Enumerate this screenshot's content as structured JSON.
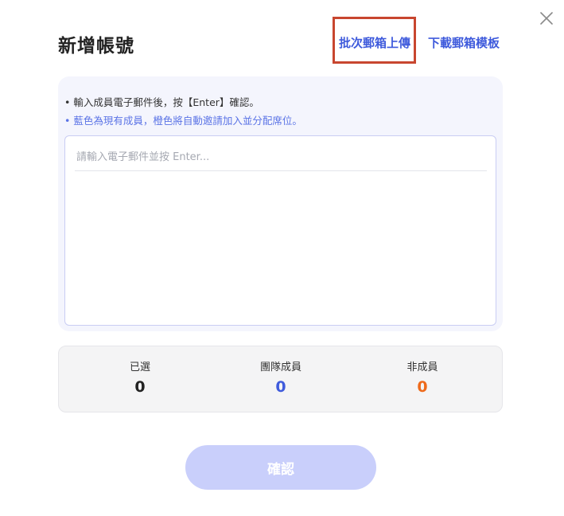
{
  "dialog": {
    "title": "新增帳號",
    "links": {
      "batch_upload": "批次郵箱上傳",
      "download_template": "下載郵箱模板"
    }
  },
  "input_panel": {
    "hint_1": "• 輸入成員電子郵件後，按【Enter】確認。",
    "hint_2": "• 藍色為現有成員，橙色將自動邀請加入並分配席位。",
    "email_placeholder": "請輸入電子郵件並按 Enter...",
    "email_value": ""
  },
  "stats": [
    {
      "label": "已選",
      "value": "0",
      "color": "#222222"
    },
    {
      "label": "團隊成員",
      "value": "0",
      "color": "#3f5bdc"
    },
    {
      "label": "非成員",
      "value": "0",
      "color": "#ee6a1b"
    }
  ],
  "confirm_label": "確認",
  "colors": {
    "accent": "#3f5bdc",
    "orange": "#ee6a1b",
    "highlight": "#c8462f",
    "button_disabled": "#c9cffb"
  },
  "icons": {
    "close": "close-icon"
  }
}
